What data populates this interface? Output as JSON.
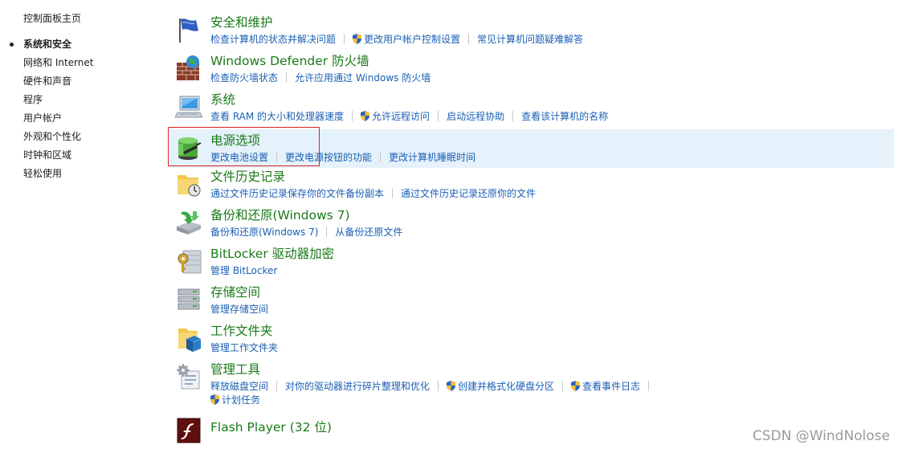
{
  "sidebar": {
    "home": "控制面板主页",
    "items": [
      {
        "label": "系统和安全"
      },
      {
        "label": "网络和 Internet"
      },
      {
        "label": "硬件和声音"
      },
      {
        "label": "程序"
      },
      {
        "label": "用户帐户"
      },
      {
        "label": "外观和个性化"
      },
      {
        "label": "时钟和区域"
      },
      {
        "label": "轻松使用"
      }
    ]
  },
  "categories": {
    "security": {
      "title": "安全和维护",
      "links": [
        "检查计算机的状态并解决问题",
        "更改用户帐户控制设置",
        "常见计算机问题疑难解答"
      ]
    },
    "firewall": {
      "title": "Windows Defender 防火墙",
      "links": [
        "检查防火墙状态",
        "允许应用通过 Windows 防火墙"
      ]
    },
    "system": {
      "title": "系统",
      "links": [
        "查看 RAM 的大小和处理器速度",
        "允许远程访问",
        "启动远程协助",
        "查看该计算机的名称"
      ]
    },
    "power": {
      "title": "电源选项",
      "links": [
        "更改电池设置",
        "更改电源按钮的功能",
        "更改计算机睡眠时间"
      ]
    },
    "filehistory": {
      "title": "文件历史记录",
      "links": [
        "通过文件历史记录保存你的文件备份副本",
        "通过文件历史记录还原你的文件"
      ]
    },
    "backup": {
      "title": "备份和还原(Windows 7)",
      "links": [
        "备份和还原(Windows 7)",
        "从备份还原文件"
      ]
    },
    "bitlocker": {
      "title": "BitLocker 驱动器加密",
      "links": [
        "管理 BitLocker"
      ]
    },
    "storage": {
      "title": "存储空间",
      "links": [
        "管理存储空间"
      ]
    },
    "workfolders": {
      "title": "工作文件夹",
      "links": [
        "管理工作文件夹"
      ]
    },
    "admintools": {
      "title": "管理工具",
      "links": [
        "释放磁盘空间",
        "对你的驱动器进行碎片整理和优化",
        "创建并格式化硬盘分区",
        "查看事件日志",
        "计划任务"
      ]
    },
    "flash": {
      "title": "Flash Player (32 位)"
    }
  },
  "watermark": "CSDN @WindNolose",
  "colors": {
    "title_green": "#1a7a1a",
    "link_blue": "#1a5fb4",
    "highlight": "#e5f1fb",
    "annotation_red": "#e02020"
  },
  "icons": {
    "security": "flag-icon",
    "firewall": "firewall-icon",
    "system": "computer-icon",
    "power": "battery-icon",
    "filehistory": "file-history-icon",
    "backup": "backup-icon",
    "bitlocker": "bitlocker-icon",
    "storage": "storage-icon",
    "workfolders": "work-folders-icon",
    "admintools": "admin-tools-icon",
    "flash": "flash-icon",
    "uac": "shield-icon"
  }
}
